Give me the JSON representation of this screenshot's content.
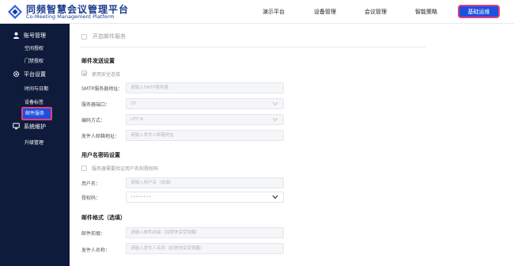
{
  "header": {
    "brand_cn": "同频智慧会议管理平台",
    "brand_en": "Co-Meeting Management Platform",
    "nav": [
      "演示平台",
      "设备管理",
      "会议管理",
      "智能策略"
    ],
    "active_nav": "基础运维"
  },
  "sidebar": {
    "groups": [
      {
        "label": "账号管理",
        "icon": "user-icon",
        "items": [
          "空间授权",
          "门禁授权"
        ]
      },
      {
        "label": "平台设置",
        "icon": "gear-icon",
        "items": [
          "时间与日期",
          "设备标签",
          "邮件服务"
        ]
      },
      {
        "label": "系统维护",
        "icon": "monitor-icon",
        "items": [
          "升级管理"
        ]
      }
    ],
    "active_item": "邮件服务"
  },
  "form": {
    "enable_email": "开启邮件服务",
    "send_section": "邮件发送设置",
    "use_ssl": "使用安全连接",
    "smtp_label": "SMTP服务器地址：",
    "smtp_placeholder": "请输入SMTP服务器",
    "port_label": "服务器端口：",
    "port_value": "25",
    "encoding_label": "编码方式：",
    "encoding_value": "UTF-8",
    "sender_label": "发件人邮箱地址：",
    "sender_placeholder": "请输入发件人邮箱地址",
    "auth_section": "用户名密码设置",
    "auth_check": "服务器需要验证用户名和授权码",
    "username_label": "用户名：",
    "username_placeholder": "请输入用户名（选填）",
    "authcode_label": "授权码：",
    "authcode_value": "••••••••",
    "format_section": "邮件格式（选填）",
    "prefix_label": "邮件前缀：",
    "prefix_placeholder": "请输入邮件前缀（如很快享受提醒）",
    "sender_name_label": "发件人名称：",
    "sender_name_placeholder": "请输入发件人名称（如很快享受提醒）"
  },
  "colors": {
    "accent": "#1d4fe0",
    "sidebar": "#0f1b3a",
    "highlight": "#e0407a"
  }
}
